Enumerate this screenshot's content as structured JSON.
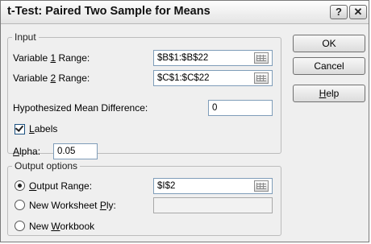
{
  "window": {
    "title": "t-Test: Paired Two Sample for Means",
    "help_glyph": "?",
    "close_glyph": "✕"
  },
  "input_group": {
    "legend": "Input",
    "variable1": {
      "label_pre": "Variable ",
      "label_key": "1",
      "label_post": " Range:",
      "value": "$B$1:$B$22"
    },
    "variable2": {
      "label_pre": "Variable ",
      "label_key": "2",
      "label_post": " Range:",
      "value": "$C$1:$C$22"
    },
    "hypothesized_mean": {
      "label": "Hypothesized Mean Difference:",
      "value": "0"
    },
    "labels_checkbox": {
      "label_key": "L",
      "label_rest": "abels",
      "checked": true
    },
    "alpha": {
      "label_key": "A",
      "label_rest": "lpha:",
      "value": "0.05"
    }
  },
  "output_group": {
    "legend": "Output options",
    "output_range": {
      "label_key": "O",
      "label_rest": "utput Range:",
      "value": "$I$2",
      "selected": true
    },
    "new_worksheet": {
      "label_pre": "New Worksheet ",
      "label_key": "P",
      "label_post": "ly:",
      "value": "",
      "selected": false
    },
    "new_workbook": {
      "label_pre": "New ",
      "label_key": "W",
      "label_post": "orkbook",
      "selected": false
    }
  },
  "buttons": {
    "ok": "OK",
    "cancel": "Cancel",
    "help_key": "H",
    "help_rest": "elp"
  }
}
